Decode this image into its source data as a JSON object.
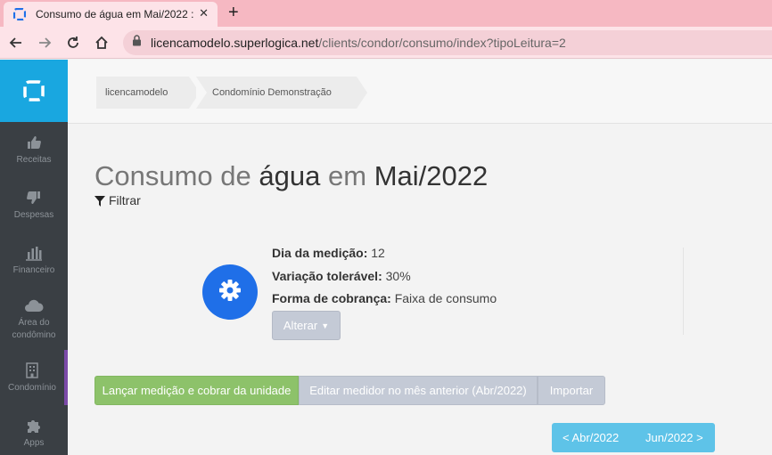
{
  "browser": {
    "tab_title": "Consumo de água em Mai/2022 :",
    "url_host": "licencamodelo.superlogica.net",
    "url_path": "/clients/condor/consumo/index?tipoLeitura=2"
  },
  "sidebar": {
    "items": [
      {
        "label": "Receitas",
        "icon": "thumbs-up-icon"
      },
      {
        "label": "Despesas",
        "icon": "thumbs-down-icon"
      },
      {
        "label": "Financeiro",
        "icon": "bar-chart-icon"
      },
      {
        "label": "Área do condômino",
        "icon": "cloud-icon"
      },
      {
        "label": "Condomínio",
        "icon": "building-icon"
      },
      {
        "label": "Apps",
        "icon": "puzzle-icon"
      }
    ]
  },
  "breadcrumb": [
    "licencamodelo",
    "Condomínio Demonstração"
  ],
  "page": {
    "title_part1": "Consumo de",
    "title_part2": "água",
    "title_part3": "em",
    "title_part4": "Mai/2022",
    "filter_label": "Filtrar"
  },
  "info": {
    "dia_label": "Dia da medição:",
    "dia_value": "12",
    "variacao_label": "Variação tolerável:",
    "variacao_value": "30%",
    "forma_label": "Forma de cobrança:",
    "forma_value": "Faixa de consumo",
    "alterar_label": "Alterar"
  },
  "actions": {
    "lancar": "Lançar medição e cobrar da unidade",
    "editar": "Editar medidor no mês anterior (Abr/2022)",
    "importar": "Importar"
  },
  "pager": {
    "prev": "< Abr/2022",
    "next": "Jun/2022 >"
  },
  "colors": {
    "brand_blue": "#19a7e0",
    "sidebar_bg": "#3a3f44",
    "green": "#8dc26a",
    "gray_btn": "#c4cad6",
    "pager": "#5ec3e8",
    "gear_circle": "#1f6fe8"
  }
}
